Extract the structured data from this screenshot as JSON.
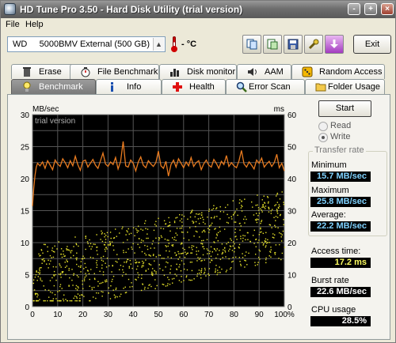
{
  "window": {
    "title": "HD Tune Pro 3.50 - Hard Disk Utility (trial version)"
  },
  "title_buttons": {
    "minimize": "-",
    "maximize": "+",
    "close": "×"
  },
  "menu": {
    "file_label": "File",
    "help_label": "Help"
  },
  "toolbar": {
    "drive_prefix": "WD",
    "drive_name": "5000BMV External (500 GB)",
    "temperature": "- °C",
    "exit_label": "Exit"
  },
  "tabs_top": [
    "Erase",
    "File Benchmark",
    "Disk monitor",
    "AAM",
    "Random Access"
  ],
  "tabs_bottom": [
    "Benchmark",
    "Info",
    "Health",
    "Error Scan",
    "Folder Usage"
  ],
  "active_tab": "Benchmark",
  "benchmark": {
    "start_label": "Start",
    "mode_read": "Read",
    "mode_write": "Write",
    "selected_mode": "Write",
    "transfer_rate_title": "Transfer rate",
    "minimum_label": "Minimum",
    "minimum_value": "15.7 MB/sec",
    "maximum_label": "Maximum",
    "maximum_value": "25.8 MB/sec",
    "average_label": "Average:",
    "average_value": "22.2 MB/sec",
    "access_time_label": "Access time:",
    "access_time_value": "17.2 ms",
    "burst_rate_label": "Burst rate",
    "burst_rate_value": "22.6 MB/sec",
    "cpu_usage_label": "CPU usage",
    "cpu_usage_value": "28.5%"
  },
  "chart_data": {
    "type": "line",
    "watermark": "trial version",
    "y_left_unit": "MB/sec",
    "y_right_unit": "ms",
    "y_left_ticks": [
      0,
      5,
      10,
      15,
      20,
      25,
      30
    ],
    "y_right_ticks": [
      0,
      10,
      20,
      30,
      40,
      50,
      60
    ],
    "x_ticks": [
      "0",
      "10",
      "20",
      "30",
      "40",
      "50",
      "60",
      "70",
      "80",
      "90",
      "100%"
    ],
    "ylim": [
      0,
      30
    ],
    "y2lim": [
      0,
      60
    ],
    "xlim": [
      0,
      100
    ],
    "grid": true,
    "series": [
      {
        "kind": "transfer rate",
        "color": "#e87b20",
        "axis": "left",
        "x": [
          0,
          0.5,
          1,
          1.5,
          2,
          3,
          4,
          5,
          6,
          7,
          8,
          9,
          10,
          11,
          12,
          13,
          14,
          15,
          16,
          17,
          18,
          19,
          20,
          21,
          22,
          23,
          24,
          25,
          26,
          27,
          28,
          29,
          30,
          31,
          32,
          33,
          34,
          35,
          36,
          37,
          38,
          39,
          40,
          41,
          42,
          43,
          44,
          45,
          46,
          47,
          48,
          49,
          50,
          51,
          52,
          53,
          54,
          55,
          56,
          57,
          58,
          59,
          60,
          61,
          62,
          63,
          64,
          65,
          66,
          67,
          68,
          69,
          70,
          71,
          72,
          73,
          74,
          75,
          76,
          77,
          78,
          79,
          80,
          81,
          82,
          83,
          84,
          85,
          86,
          87,
          88,
          89,
          90,
          91,
          92,
          93,
          94,
          95,
          96,
          97,
          98,
          99,
          100
        ],
        "values": [
          15.7,
          18.5,
          20.5,
          21.8,
          22.4,
          22.0,
          22.6,
          21.6,
          22.8,
          22.1,
          21.4,
          22.9,
          22.3,
          21.9,
          23.1,
          22.5,
          21.7,
          22.8,
          22.0,
          23.5,
          22.2,
          21.3,
          22.7,
          22.9,
          21.8,
          22.4,
          23.0,
          22.1,
          21.6,
          22.8,
          24.0,
          22.3,
          21.9,
          22.6,
          22.2,
          23.3,
          21.5,
          22.7,
          25.8,
          22.0,
          21.8,
          22.9,
          22.4,
          21.2,
          22.6,
          23.4,
          22.1,
          21.7,
          22.8,
          22.3,
          21.9,
          22.5,
          24.3,
          22.0,
          21.6,
          22.7,
          20.4,
          22.2,
          22.9,
          21.8,
          23.1,
          22.4,
          21.7,
          22.6,
          22.0,
          23.3,
          21.9,
          22.5,
          22.8,
          21.4,
          22.3,
          22.9,
          22.1,
          21.8,
          23.0,
          22.4,
          21.6,
          22.7,
          22.2,
          23.6,
          21.9,
          22.5,
          22.0,
          21.7,
          22.8,
          24.4,
          22.3,
          21.8,
          22.6,
          22.1,
          21.5,
          22.9,
          22.4,
          23.2,
          21.8,
          22.3,
          22.7,
          21.9,
          22.5,
          23.8,
          21.7,
          22.4,
          21.2
        ]
      },
      {
        "kind": "access time",
        "color": "#e6e22a",
        "axis": "right",
        "points_count": 1000,
        "min_ms": 2,
        "max_ms": 36,
        "average_ms": 17.2
      }
    ]
  }
}
